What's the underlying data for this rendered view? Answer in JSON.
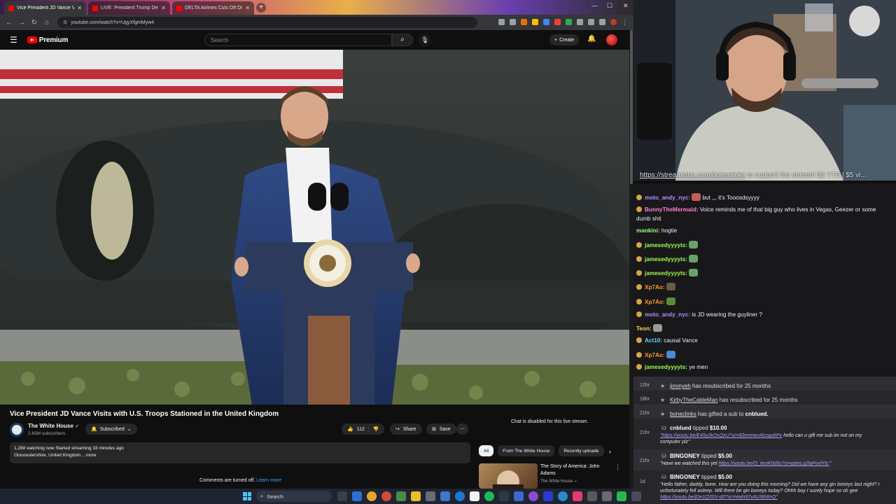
{
  "browser": {
    "tabs": [
      {
        "title": "Vice President JD Vance Vi",
        "active": true
      },
      {
        "title": "LIVE: President Trump Delivers",
        "active": false
      },
      {
        "title": "DELTA Airlines Cuts Off Drinks",
        "active": false
      }
    ],
    "new_tab": "+",
    "url": "youtube.com/watch?v=UgyXfgmMyw4"
  },
  "youtube": {
    "logo_text": "Premium",
    "search_placeholder": "Search",
    "create_label": "Create",
    "video_title": "Vice President JD Vance Visits with U.S. Troops Stationed in the United Kingdom",
    "channel_name": "The White House",
    "channel_subs": "2.65M subscribers",
    "subscribed_label": "Subscribed",
    "likes": "112",
    "share_label": "Share",
    "save_label": "Save",
    "desc_line1": "1,288 watching now  Started streaming 33 minutes ago",
    "desc_line2": "Gloucestershire, United Kingdom ...more",
    "comments_off": "Comments are turned off.",
    "learn_more": "Learn more",
    "chat_disabled": "Chat is disabled for this live stream.",
    "chips": [
      "All",
      "From The White House",
      "Recently uploade"
    ],
    "rec_title": "The Story of America: John Adams",
    "rec_channel": "The White House"
  },
  "webcam": {
    "ticker_link": "https://streamlabs.com/boneclinks",
    "ticker_rest": " to support the stream! $2 TTS | $5 vi..."
  },
  "chat": [
    {
      "user": "moto_andy_nyc",
      "color": "#b58cff",
      "text": "but ,,, it's Tooosdsyyyy",
      "badge": true,
      "emote": "#c85a5a"
    },
    {
      "user": "BunnyTheMermaid",
      "color": "#ff7fd0",
      "text": "Voice reminds me of that big guy who lives in Vegas, Geezer or some",
      "text2": "dumb shit",
      "badge": true
    },
    {
      "user": "mankini",
      "color": "#9aff7a",
      "text": "hogtie",
      "badge": false
    },
    {
      "user": "jamesedyyyyts",
      "color": "#9aff4a",
      "text": "",
      "badge": true,
      "emote": "#6aa06a"
    },
    {
      "user": "jamesedyyyyts",
      "color": "#9aff4a",
      "text": "",
      "badge": true,
      "emote": "#6aa06a"
    },
    {
      "user": "jamesedyyyyts",
      "color": "#9aff4a",
      "text": "",
      "badge": true,
      "emote": "#6aa06a"
    },
    {
      "user": "Xp7Ao",
      "color": "#ff9a2a",
      "text": "",
      "badge": true,
      "emote": "#6a5a4a"
    },
    {
      "user": "Xp7Ao",
      "color": "#ff9a2a",
      "text": "",
      "badge": true,
      "emote": "#5a8a3a"
    },
    {
      "user": "moto_andy_nyc",
      "color": "#b58cff",
      "text": "is JD wearing the guyliner ?",
      "badge": true
    },
    {
      "user": "Teon",
      "color": "#ffd84a",
      "text": "",
      "badge": false,
      "emote": "#999999"
    },
    {
      "user": "Act10",
      "color": "#6ad0ff",
      "text": "causal Vance",
      "badge": true
    },
    {
      "user": "Xp7Ao",
      "color": "#ff9a2a",
      "text": "",
      "badge": true,
      "emote": "#4a8ad0"
    },
    {
      "user": "jamesedyyyyts",
      "color": "#9aff4a",
      "text": "ye men",
      "badge": true
    }
  ],
  "events": [
    {
      "time": "12hr",
      "name": "jimmyeh",
      "text": "has resubscribed for 25 months"
    },
    {
      "time": "18hr",
      "name": "KirbyTheCableMan",
      "text": "has resubscribed for 25 months"
    },
    {
      "time": "21hr",
      "name": "boneclinks",
      "text": "has gifted a sub to",
      "target": "cnblued."
    },
    {
      "time": "21hr",
      "name": "cnblued",
      "text": "tipped",
      "amount": "$10.00",
      "note_link": "https://youtu.be/E45y2kOsQzU?si=IEbmmwrAlcogxbPx",
      "note": " hello can u gift me sub im not on my",
      "note2": "computer plz"
    },
    {
      "time": "21hr",
      "name": "BINGONEY",
      "text": "tipped",
      "amount": "$5.00",
      "note": "\"Have we watched this yet ",
      "note_link": "https://youtu.be/O_tesiK0d5s?si=ipbeLq2laPovfYb.",
      "note_end": "\""
    },
    {
      "time": "1d",
      "name": "BINGONEY",
      "text": "tipped",
      "amount": "$5.00",
      "note": "\"Hello father, daddy, bone. How are you doing this morning? Did we have any gin boneys last night? I",
      "note2": "unfortunately fell asleep. Will there be gin boneys today? Ohhh boy I surely hope so oh gee",
      "note_link": "https://youtu.be/jDe1Q3SV-d0?si=Hwln97vAU9thtInQ\""
    }
  ],
  "taskbar": {
    "search_label": "Search"
  }
}
